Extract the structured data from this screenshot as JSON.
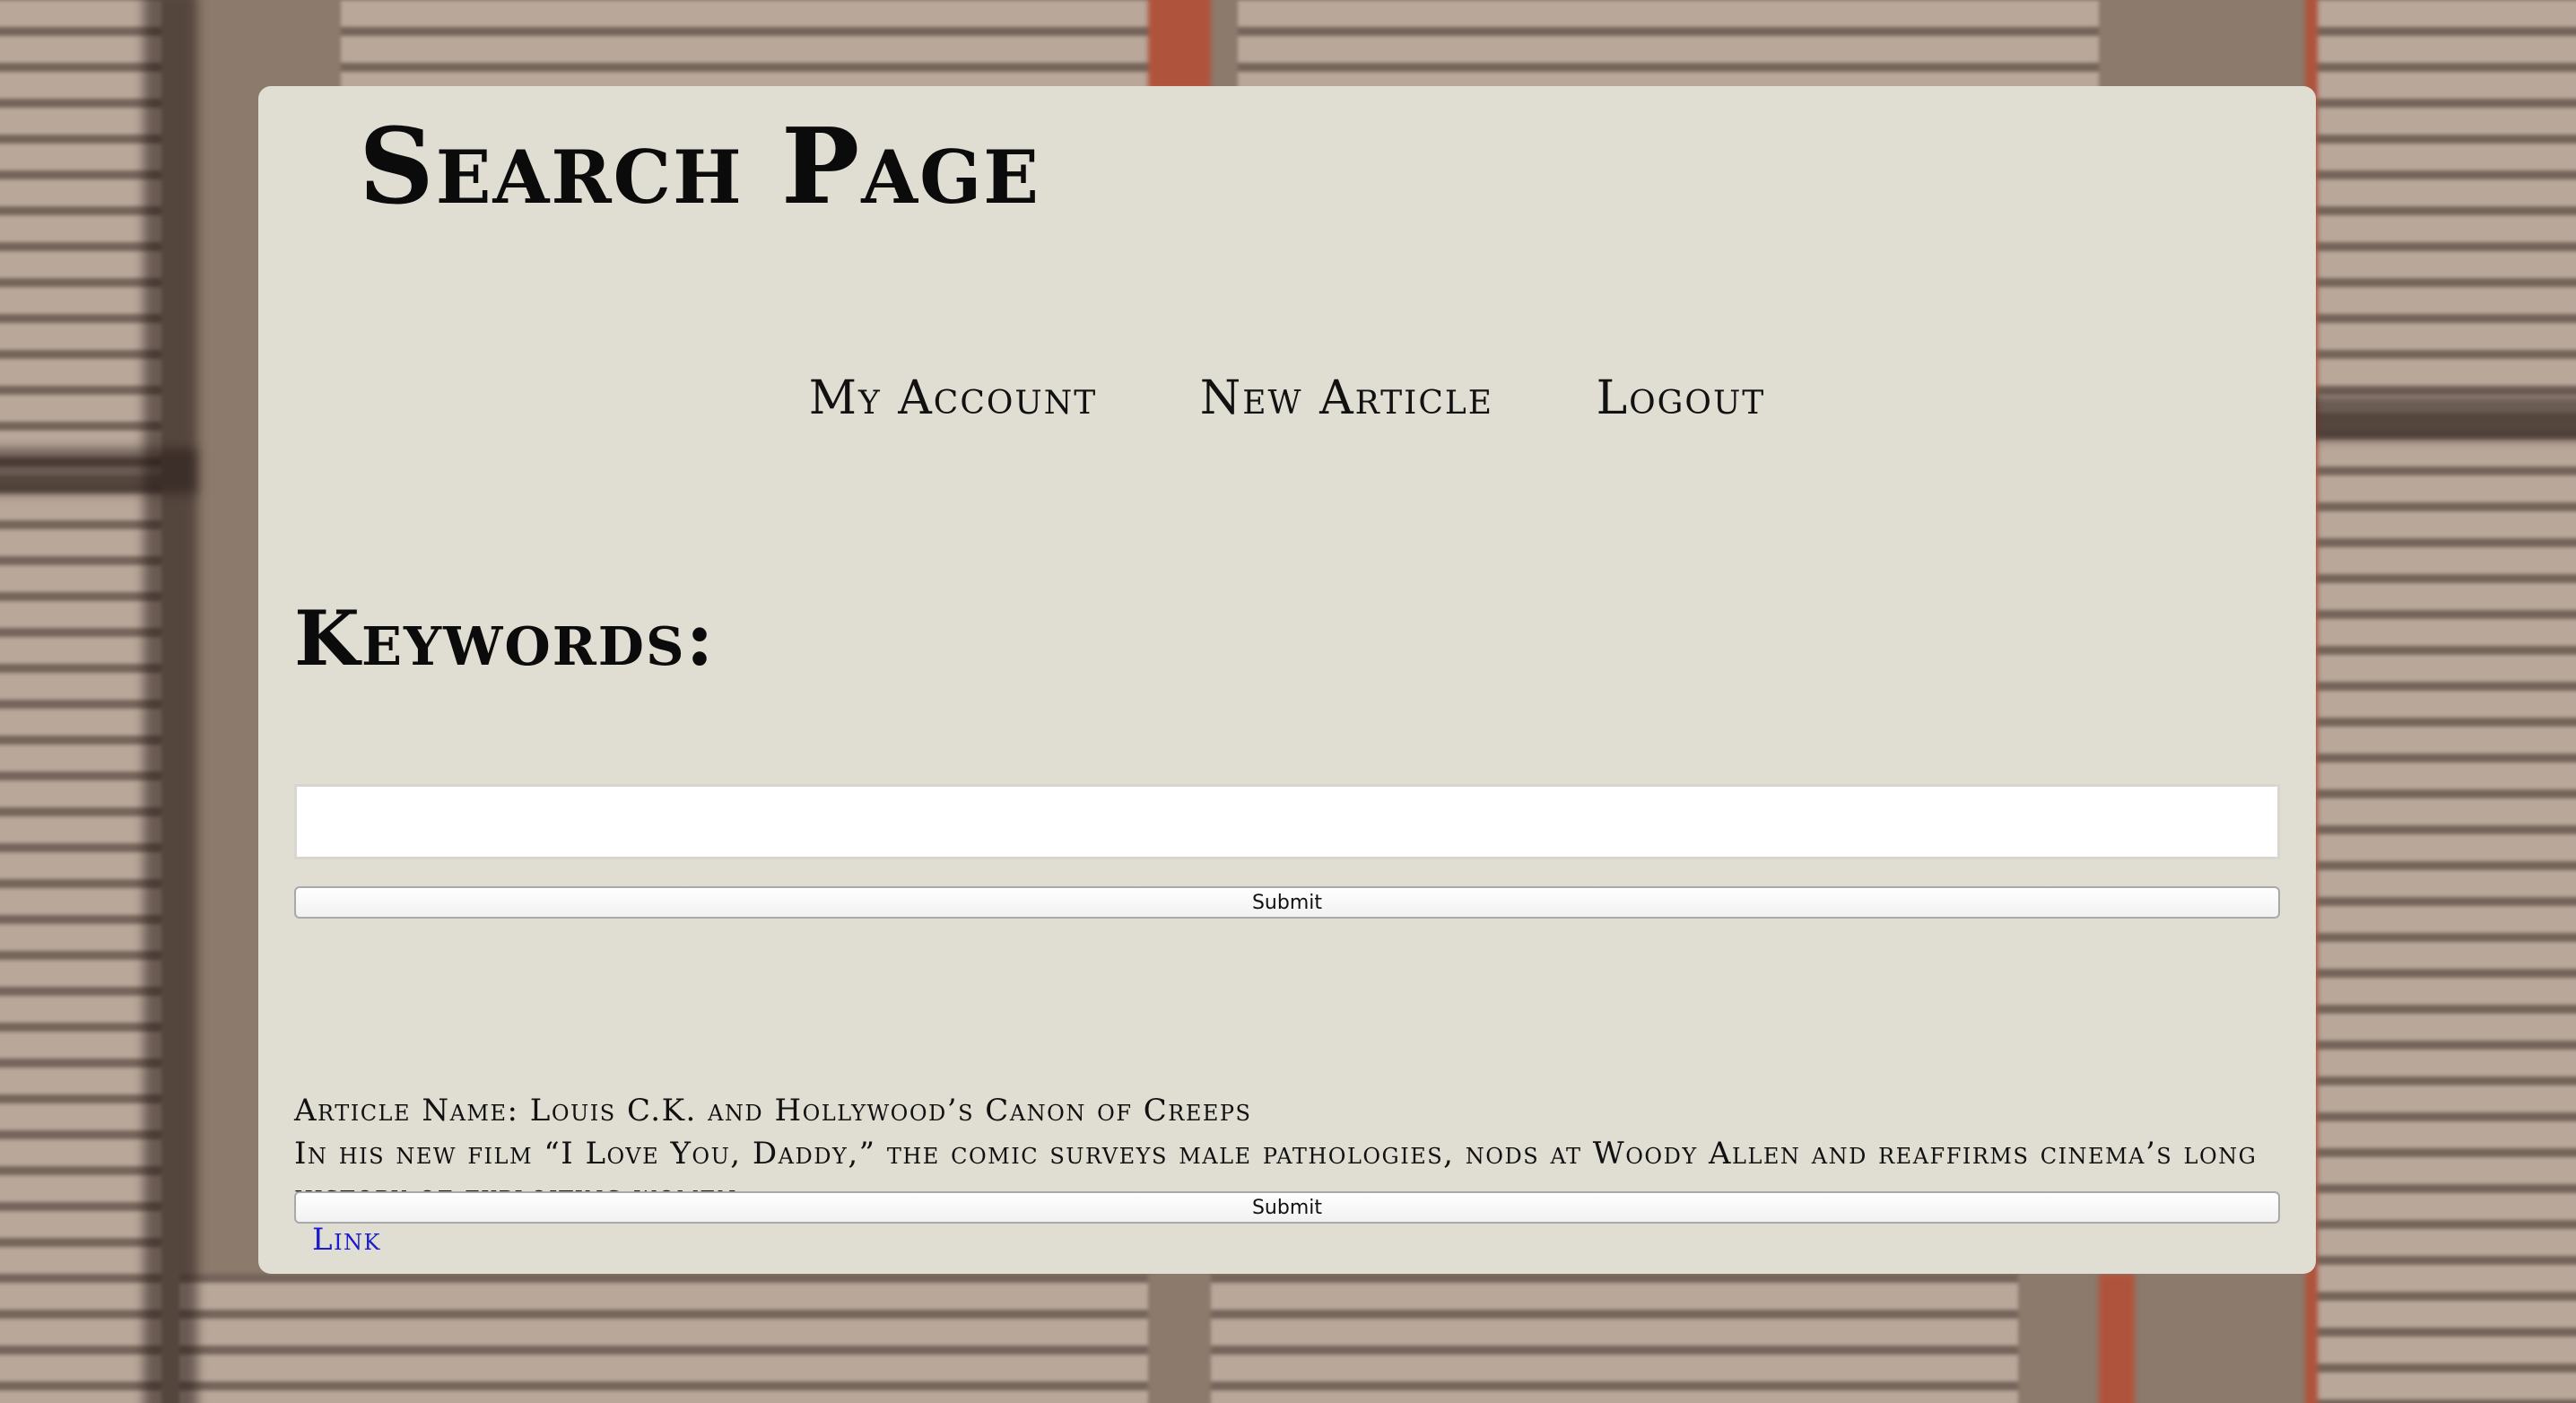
{
  "header": {
    "title": "Search Page"
  },
  "nav": {
    "items": [
      {
        "label": "My Account"
      },
      {
        "label": "New Article"
      },
      {
        "label": "Logout"
      }
    ]
  },
  "search": {
    "heading": "Keywords:",
    "value": "",
    "placeholder": "",
    "submit_label": "Submit"
  },
  "results": [
    {
      "name_label": "Article Name:",
      "name": "Louis C.K. and Hollywood’s Canon of Creeps",
      "summary": "In his new film “I Love You, Daddy,” the comic surveys male pathologies, nods at Woody Allen and reaffirms cinema’s long history of exploiting women.",
      "link_label": "Link",
      "submit_label": "Submit"
    }
  ],
  "colors": {
    "panel": "#e0ddd2",
    "link": "#1a1ad0",
    "text": "#111111"
  }
}
